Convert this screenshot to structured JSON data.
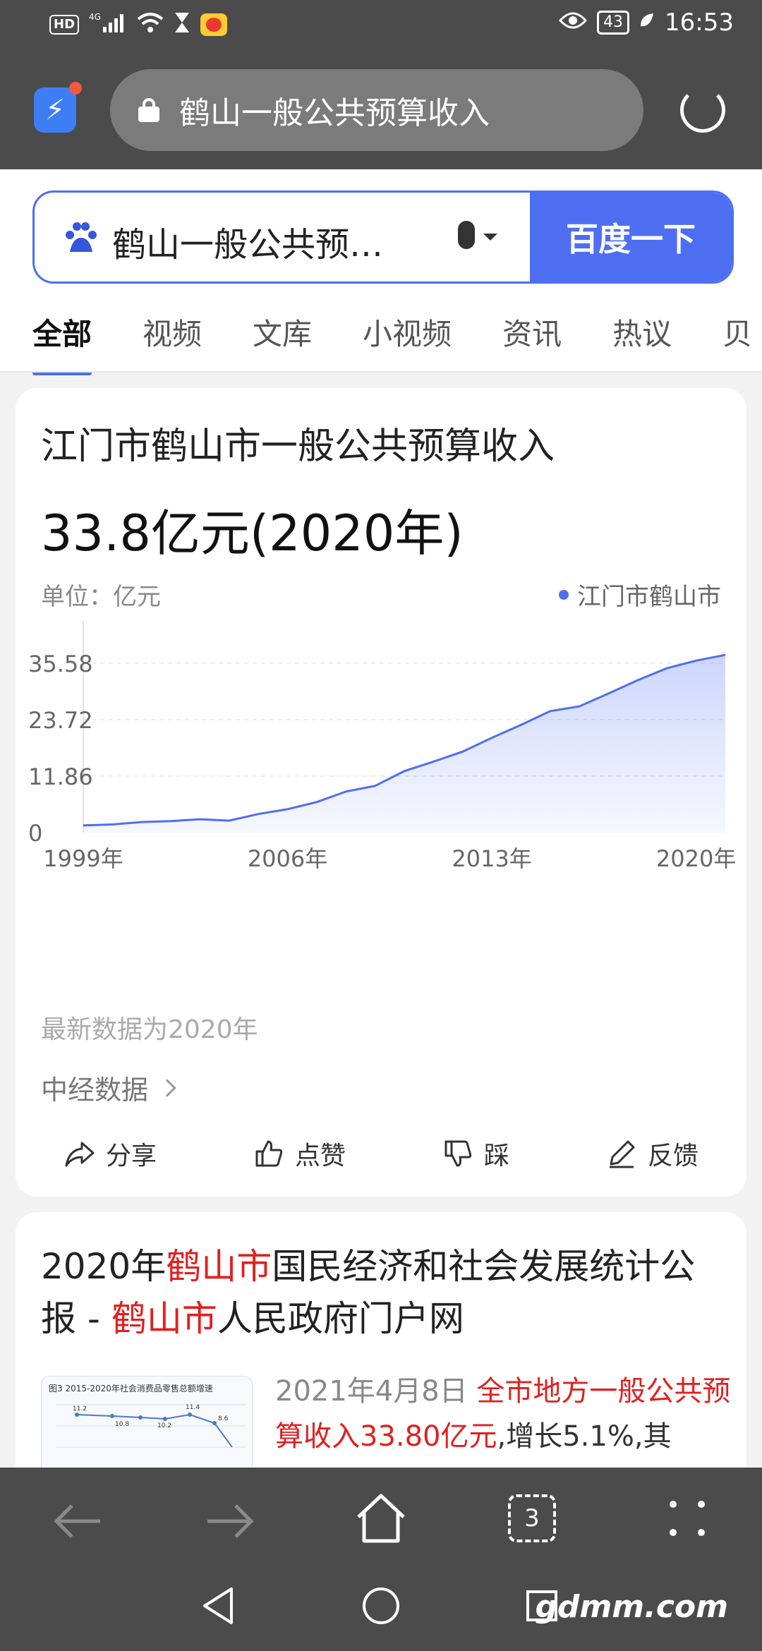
{
  "status_bar": {
    "left_badges": [
      "HD",
      "4G"
    ],
    "battery": "43",
    "time": "16:53"
  },
  "address_bar": {
    "url_text": "鹤山一般公共预算收入"
  },
  "search": {
    "query": "鹤山一般公共预…",
    "button_label": "百度一下"
  },
  "tabs": [
    {
      "label": "全部",
      "active": true
    },
    {
      "label": "视频",
      "active": false
    },
    {
      "label": "文库",
      "active": false
    },
    {
      "label": "小视频",
      "active": false
    },
    {
      "label": "资讯",
      "active": false
    },
    {
      "label": "热议",
      "active": false
    },
    {
      "label": "贝",
      "active": false
    }
  ],
  "result_card": {
    "title": "江门市鹤山市一般公共预算收入",
    "value": "33.8亿元(2020年)",
    "unit_label": "单位：亿元",
    "legend": "江门市鹤山市",
    "latest_note": "最新数据为2020年",
    "source": "中经数据",
    "actions": {
      "share": "分享",
      "like": "点赞",
      "dislike": "踩",
      "feedback": "反馈"
    }
  },
  "chart_data": {
    "type": "area",
    "x": [
      1999,
      2000,
      2001,
      2002,
      2003,
      2004,
      2005,
      2006,
      2007,
      2008,
      2009,
      2010,
      2011,
      2012,
      2013,
      2014,
      2015,
      2016,
      2017,
      2018,
      2019,
      2020,
      2021
    ],
    "x_tick_labels": [
      "1999年",
      "2006年",
      "2013年",
      "2020年"
    ],
    "series": [
      {
        "name": "江门市鹤山市",
        "values": [
          1.5,
          1.7,
          2.2,
          2.4,
          2.8,
          2.5,
          3.9,
          4.9,
          6.4,
          8.6,
          9.8,
          12.9,
          14.9,
          17.0,
          19.9,
          22.6,
          25.5,
          26.5,
          29.2,
          32.0,
          34.5,
          36.1,
          37.3
        ]
      }
    ],
    "y_ticks": [
      "0",
      "11.86",
      "23.72",
      "35.58"
    ],
    "ylim": [
      0,
      40
    ],
    "color": "#4e6ef2"
  },
  "result_two": {
    "title_parts": [
      {
        "text": "2020年",
        "hl": false
      },
      {
        "text": "鹤山市",
        "hl": true
      },
      {
        "text": "国民经济和社会发展统计公报 - ",
        "hl": false
      },
      {
        "text": "鹤山市",
        "hl": true
      },
      {
        "text": "人民政府门户网",
        "hl": false
      }
    ],
    "date": "2021年4月8日",
    "snippet_highlight": "全市地方一般公共预算收入33.80亿元",
    "snippet_rest": ",增长5.1%,其",
    "thumb_caption": "图3 2015-2020年社会消费品零售总额增速",
    "thumb_labels": [
      "11.2",
      "10.8",
      "10.2",
      "11.4",
      "8.6"
    ]
  },
  "bottom_nav": {
    "tab_count": "3"
  },
  "watermark": "gdmm.com"
}
